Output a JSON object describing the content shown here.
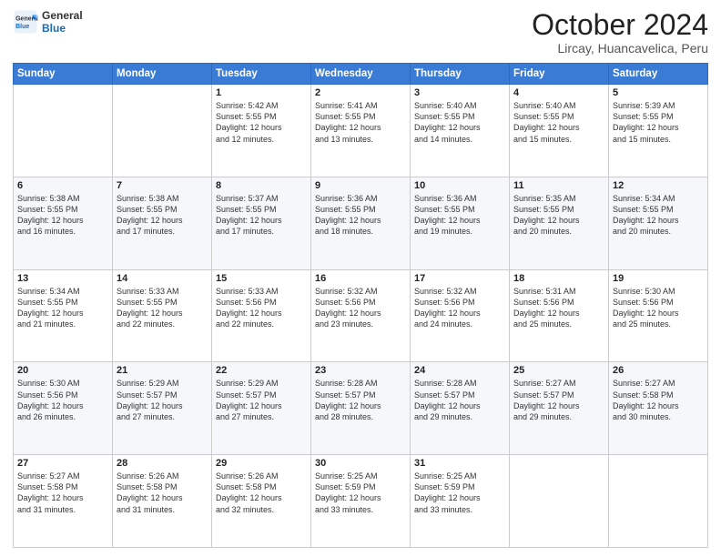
{
  "logo": {
    "line1": "General",
    "line2": "Blue"
  },
  "header": {
    "month": "October 2024",
    "location": "Lircay, Huancavelica, Peru"
  },
  "weekdays": [
    "Sunday",
    "Monday",
    "Tuesday",
    "Wednesday",
    "Thursday",
    "Friday",
    "Saturday"
  ],
  "weeks": [
    [
      {
        "day": "",
        "content": ""
      },
      {
        "day": "",
        "content": ""
      },
      {
        "day": "1",
        "content": "Sunrise: 5:42 AM\nSunset: 5:55 PM\nDaylight: 12 hours\nand 12 minutes."
      },
      {
        "day": "2",
        "content": "Sunrise: 5:41 AM\nSunset: 5:55 PM\nDaylight: 12 hours\nand 13 minutes."
      },
      {
        "day": "3",
        "content": "Sunrise: 5:40 AM\nSunset: 5:55 PM\nDaylight: 12 hours\nand 14 minutes."
      },
      {
        "day": "4",
        "content": "Sunrise: 5:40 AM\nSunset: 5:55 PM\nDaylight: 12 hours\nand 15 minutes."
      },
      {
        "day": "5",
        "content": "Sunrise: 5:39 AM\nSunset: 5:55 PM\nDaylight: 12 hours\nand 15 minutes."
      }
    ],
    [
      {
        "day": "6",
        "content": "Sunrise: 5:38 AM\nSunset: 5:55 PM\nDaylight: 12 hours\nand 16 minutes."
      },
      {
        "day": "7",
        "content": "Sunrise: 5:38 AM\nSunset: 5:55 PM\nDaylight: 12 hours\nand 17 minutes."
      },
      {
        "day": "8",
        "content": "Sunrise: 5:37 AM\nSunset: 5:55 PM\nDaylight: 12 hours\nand 17 minutes."
      },
      {
        "day": "9",
        "content": "Sunrise: 5:36 AM\nSunset: 5:55 PM\nDaylight: 12 hours\nand 18 minutes."
      },
      {
        "day": "10",
        "content": "Sunrise: 5:36 AM\nSunset: 5:55 PM\nDaylight: 12 hours\nand 19 minutes."
      },
      {
        "day": "11",
        "content": "Sunrise: 5:35 AM\nSunset: 5:55 PM\nDaylight: 12 hours\nand 20 minutes."
      },
      {
        "day": "12",
        "content": "Sunrise: 5:34 AM\nSunset: 5:55 PM\nDaylight: 12 hours\nand 20 minutes."
      }
    ],
    [
      {
        "day": "13",
        "content": "Sunrise: 5:34 AM\nSunset: 5:55 PM\nDaylight: 12 hours\nand 21 minutes."
      },
      {
        "day": "14",
        "content": "Sunrise: 5:33 AM\nSunset: 5:55 PM\nDaylight: 12 hours\nand 22 minutes."
      },
      {
        "day": "15",
        "content": "Sunrise: 5:33 AM\nSunset: 5:56 PM\nDaylight: 12 hours\nand 22 minutes."
      },
      {
        "day": "16",
        "content": "Sunrise: 5:32 AM\nSunset: 5:56 PM\nDaylight: 12 hours\nand 23 minutes."
      },
      {
        "day": "17",
        "content": "Sunrise: 5:32 AM\nSunset: 5:56 PM\nDaylight: 12 hours\nand 24 minutes."
      },
      {
        "day": "18",
        "content": "Sunrise: 5:31 AM\nSunset: 5:56 PM\nDaylight: 12 hours\nand 25 minutes."
      },
      {
        "day": "19",
        "content": "Sunrise: 5:30 AM\nSunset: 5:56 PM\nDaylight: 12 hours\nand 25 minutes."
      }
    ],
    [
      {
        "day": "20",
        "content": "Sunrise: 5:30 AM\nSunset: 5:56 PM\nDaylight: 12 hours\nand 26 minutes."
      },
      {
        "day": "21",
        "content": "Sunrise: 5:29 AM\nSunset: 5:57 PM\nDaylight: 12 hours\nand 27 minutes."
      },
      {
        "day": "22",
        "content": "Sunrise: 5:29 AM\nSunset: 5:57 PM\nDaylight: 12 hours\nand 27 minutes."
      },
      {
        "day": "23",
        "content": "Sunrise: 5:28 AM\nSunset: 5:57 PM\nDaylight: 12 hours\nand 28 minutes."
      },
      {
        "day": "24",
        "content": "Sunrise: 5:28 AM\nSunset: 5:57 PM\nDaylight: 12 hours\nand 29 minutes."
      },
      {
        "day": "25",
        "content": "Sunrise: 5:27 AM\nSunset: 5:57 PM\nDaylight: 12 hours\nand 29 minutes."
      },
      {
        "day": "26",
        "content": "Sunrise: 5:27 AM\nSunset: 5:58 PM\nDaylight: 12 hours\nand 30 minutes."
      }
    ],
    [
      {
        "day": "27",
        "content": "Sunrise: 5:27 AM\nSunset: 5:58 PM\nDaylight: 12 hours\nand 31 minutes."
      },
      {
        "day": "28",
        "content": "Sunrise: 5:26 AM\nSunset: 5:58 PM\nDaylight: 12 hours\nand 31 minutes."
      },
      {
        "day": "29",
        "content": "Sunrise: 5:26 AM\nSunset: 5:58 PM\nDaylight: 12 hours\nand 32 minutes."
      },
      {
        "day": "30",
        "content": "Sunrise: 5:25 AM\nSunset: 5:59 PM\nDaylight: 12 hours\nand 33 minutes."
      },
      {
        "day": "31",
        "content": "Sunrise: 5:25 AM\nSunset: 5:59 PM\nDaylight: 12 hours\nand 33 minutes."
      },
      {
        "day": "",
        "content": ""
      },
      {
        "day": "",
        "content": ""
      }
    ]
  ]
}
